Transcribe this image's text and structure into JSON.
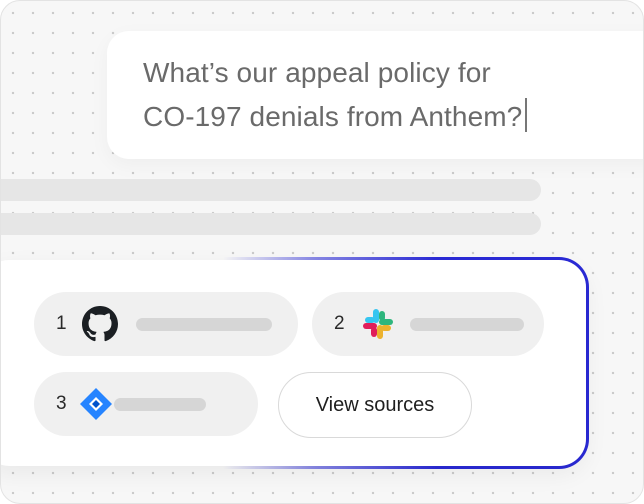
{
  "query": {
    "line1": "What’s our appeal policy for",
    "line2": "CO-197 denials from Anthem?"
  },
  "sources": {
    "items": [
      {
        "number": "1",
        "icon": "github-icon"
      },
      {
        "number": "2",
        "icon": "slack-icon"
      },
      {
        "number": "3",
        "icon": "jira-icon"
      }
    ],
    "view_sources_label": "View sources"
  },
  "colors": {
    "accent_border": "#2a2ad6",
    "jira_blue": "#2684ff",
    "slack": [
      "#36c5f0",
      "#2eb67d",
      "#ecb22e",
      "#e01e5a"
    ]
  }
}
